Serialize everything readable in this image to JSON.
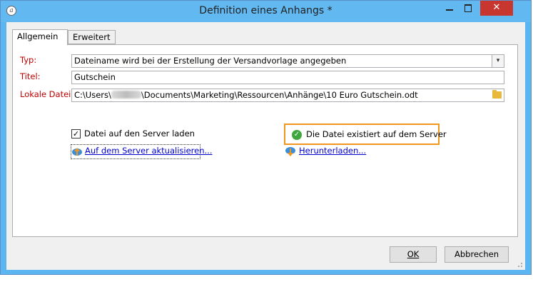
{
  "window": {
    "title": "Definition eines Anhangs *",
    "controls": {
      "close": "✕"
    }
  },
  "tabs": [
    {
      "label": "Allgemein",
      "active": true
    },
    {
      "label": "Erweitert",
      "active": false
    }
  ],
  "form": {
    "type_label": "Typ:",
    "type_value": "Dateiname wird bei der Erstellung der Versandvorlage angegeben",
    "title_label": "Titel:",
    "title_value": "Gutschein",
    "file_label": "Lokale Datei:",
    "file_path_prefix": "C:\\Users\\",
    "file_path_suffix": "\\Documents\\Marketing\\Ressourcen\\Anhänge\\10 Euro Gutschein.odt",
    "upload_checkbox_label": "Datei auf den Server laden",
    "upload_checked": true,
    "update_link": "Auf dem Server aktualisieren...",
    "status_text": "Die Datei existiert auf dem Server",
    "download_link": "Herunterladen..."
  },
  "buttons": {
    "ok": "OK",
    "cancel": "Abbrechen"
  },
  "colors": {
    "label_red": "#c00000",
    "highlight_orange": "#f0961e",
    "link_blue": "#0000cc",
    "titlebar_blue": "#62b8f1",
    "success_green": "#3fa73f"
  }
}
